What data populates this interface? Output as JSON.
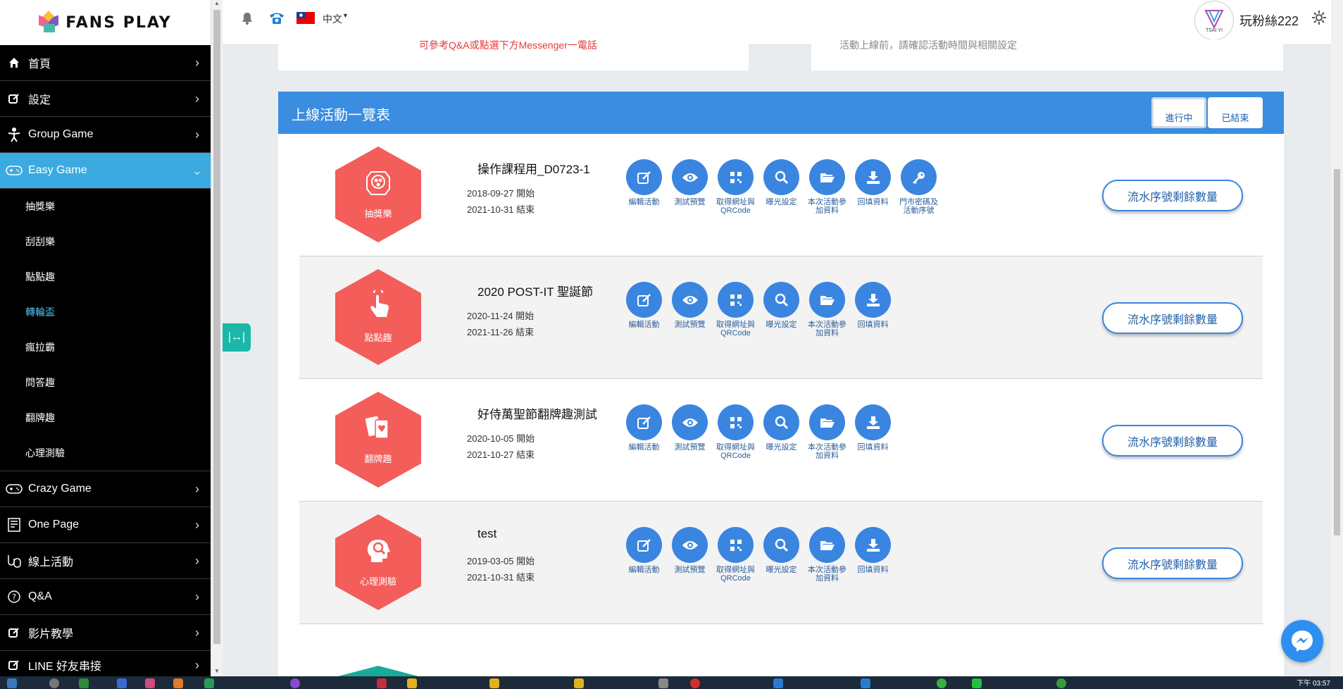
{
  "app": {
    "logo_text": "FANS PLAY"
  },
  "sidebar": {
    "items": [
      {
        "label": "首頁",
        "icon": "home-icon"
      },
      {
        "label": "設定",
        "icon": "edit-icon"
      },
      {
        "label": "Group Game",
        "icon": "group-game-icon"
      },
      {
        "label": "Easy Game",
        "icon": "gamepad-icon",
        "expanded": true
      },
      {
        "label": "Crazy Game",
        "icon": "gamepad-icon"
      },
      {
        "label": "One Page",
        "icon": "page-icon"
      },
      {
        "label": "線上活動",
        "icon": "online-icon"
      },
      {
        "label": "Q&A",
        "icon": "question-icon"
      },
      {
        "label": "影片教學",
        "icon": "edit-icon"
      },
      {
        "label": "LINE 好友串接",
        "icon": "edit-icon"
      }
    ],
    "sub_items": [
      "抽獎樂",
      "刮刮樂",
      "點點趣",
      "轉輪盃",
      "瘋拉霸",
      "問答趣",
      "翻牌趣",
      "心理測驗"
    ],
    "current_sub": "轉輪盃"
  },
  "topbar": {
    "language": "中文",
    "user_name": "玩粉絲222",
    "avatar_text": "TSAI YI"
  },
  "top_cards": {
    "left_text": "可參考Q&A或點選下方Messenger一電話",
    "right_text": "活動上線前，請確認活動時間與相關設定"
  },
  "panel": {
    "title": "上線活動一覽表",
    "tabs": [
      {
        "label": "進行中",
        "active": true
      },
      {
        "label": "已結束",
        "active": false
      }
    ]
  },
  "action_labels": {
    "edit": "編輯活動",
    "preview": "測試預覽",
    "qrcode_l1": "取得網址與",
    "qrcode_l2": "QRCode",
    "exposure": "曝光設定",
    "data_l1": "本次活動參",
    "data_l2": "加資料",
    "download": "回填資料",
    "keys_l1": "門市密碼及",
    "keys_l2": "活動序號"
  },
  "start_suffix": "開始",
  "end_suffix": "結束",
  "serial_label": "流水序號剩餘數量",
  "activities": [
    {
      "name": "操作課程用_D0723-1",
      "type": "抽獎樂",
      "start": "2018-09-27",
      "end": "2021-10-31",
      "has_keys": true
    },
    {
      "name": "2020 POST-IT 聖誕節",
      "type": "點點趣",
      "start": "2020-11-24",
      "end": "2021-11-26",
      "has_keys": false
    },
    {
      "name": "好侍萬聖節翻牌趣測試",
      "type": "翻牌趣",
      "start": "2020-10-05",
      "end": "2021-10-27",
      "has_keys": false
    },
    {
      "name": "test",
      "type": "心理測驗",
      "start": "2019-03-05",
      "end": "2021-10-31",
      "has_keys": false
    }
  ],
  "taskbar": {
    "clock": "下午 03:57"
  },
  "colors": {
    "primary": "#3a8de0",
    "hex_red": "#f35d5a",
    "sidebar_active": "#3aaae0",
    "teal": "#1ab8a8"
  }
}
